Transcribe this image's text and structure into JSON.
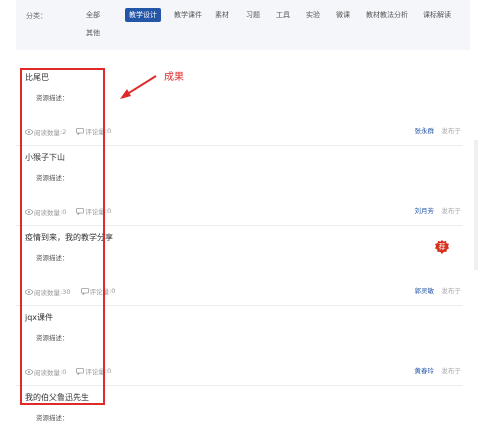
{
  "filter": {
    "label": "分类：",
    "options": [
      {
        "label": "全部"
      },
      {
        "label": "教学设计",
        "active": true
      },
      {
        "label": "教学课件"
      },
      {
        "label": "素材"
      },
      {
        "label": "习题"
      },
      {
        "label": "工具"
      },
      {
        "label": "实验"
      },
      {
        "label": "微课"
      },
      {
        "label": "教材教法分析"
      },
      {
        "label": "课标解读"
      },
      {
        "label": "其他"
      }
    ]
  },
  "items": [
    {
      "title": "比尾巴",
      "desc_label": "资源描述：",
      "views_label": "阅读数量",
      "views": "2",
      "comments_label": "评论量",
      "comments": "0",
      "author": "张永群",
      "published": "发布于"
    },
    {
      "title": "小猴子下山",
      "desc_label": "资源描述：",
      "views_label": "阅读数量",
      "views": "0",
      "comments_label": "评论量",
      "comments": "0",
      "author": "刘月芳",
      "published": "发布于"
    },
    {
      "title": "疫情到来，我的教学分享",
      "desc_label": "资源描述：",
      "views_label": "阅读数量",
      "views": "30",
      "comments_label": "评论量",
      "comments": "0",
      "author": "郭灵敏",
      "published": "发布于",
      "badge": "荐"
    },
    {
      "title": "jqx课件",
      "desc_label": "资源描述：",
      "views_label": "阅读数量",
      "views": "0",
      "comments_label": "评论量",
      "comments": "0",
      "author": "黄春玲",
      "published": "发布于"
    },
    {
      "title": "我的伯父鲁迅先生",
      "desc_label": "资源描述："
    }
  ],
  "annotation": {
    "text": "成果",
    "color": "#e02a2a"
  },
  "colors": {
    "accent": "#2456a8",
    "filter_bg": "#f4f6fa",
    "badge": "#d6301d"
  }
}
